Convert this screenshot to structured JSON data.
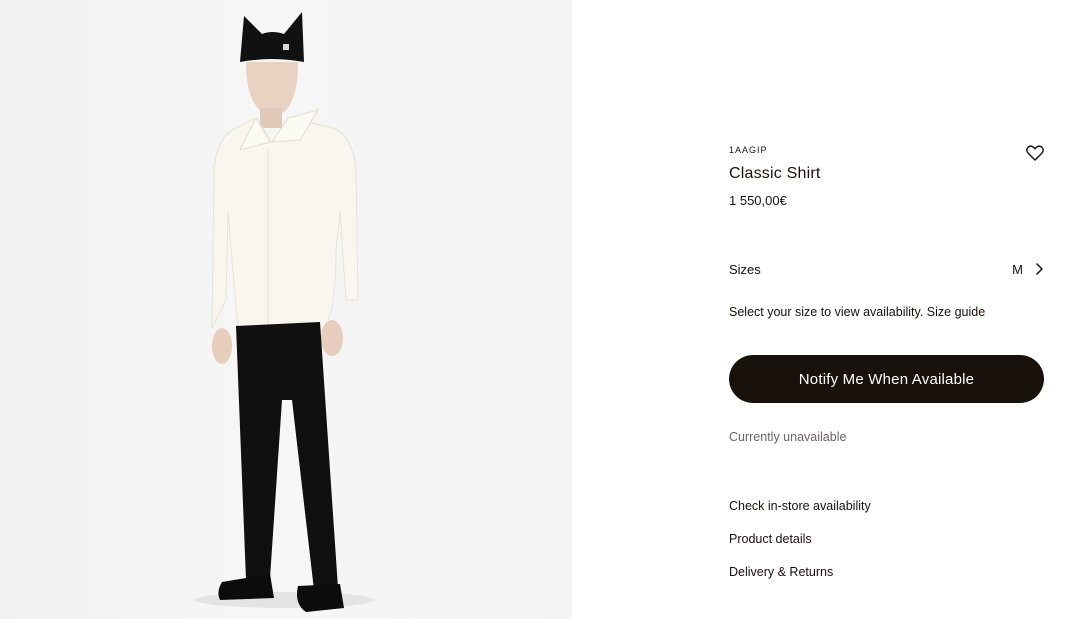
{
  "product": {
    "sku": "1AAGIP",
    "title": "Classic Shirt",
    "price": "1 550,00€"
  },
  "sizes": {
    "label": "Sizes",
    "selected": "M"
  },
  "size_help": {
    "text": "Select your size to view availability. ",
    "guide_link": "Size guide"
  },
  "notify_button": {
    "label": "Notify Me When Available"
  },
  "availability": {
    "status": "Currently unavailable"
  },
  "links": [
    {
      "label": "Check in-store availability"
    },
    {
      "label": "Product details"
    },
    {
      "label": "Delivery & Returns"
    }
  ],
  "icons": {
    "wishlist": "heart-icon",
    "sizes": "chevron-right-icon"
  },
  "colors": {
    "primary": "#19110b",
    "muted": "#6d6662",
    "button_text": "#ffffff"
  }
}
